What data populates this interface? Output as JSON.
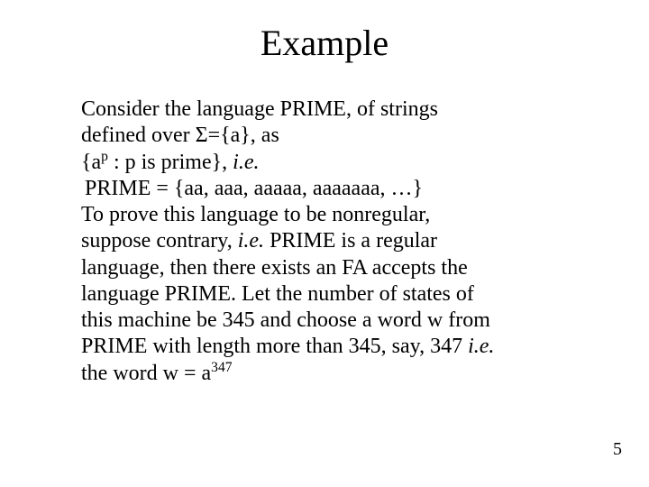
{
  "title": "Example",
  "body": {
    "line1": "Consider the language PRIME, of strings",
    "line2_pre": "defined over ",
    "line2_sigma": "Σ",
    "line2_post": "={a}, as",
    "line3_pre": "{a",
    "line3_sup": "p",
    "line3_mid": " : p is prime}, ",
    "line3_ie": "i.e.",
    "line4_pre": " PRIME = {aa, aaa, aaaaa, aaaaaaa, …}",
    "line5": "To prove this language to be nonregular,",
    "line6_pre": "suppose contrary, ",
    "line6_ie": "i.e.",
    "line6_post": " PRIME is a regular",
    "line7": "language, then there exists an FA accepts the",
    "line8": "language PRIME. Let the number of states of",
    "line9": "this machine be 345 and choose a word w from",
    "line10_pre": "PRIME with length more than 345, say, 347 ",
    "line10_ie": "i.e.",
    "line11_pre": "the word w = a",
    "line11_sup": "347"
  },
  "page_number": "5"
}
